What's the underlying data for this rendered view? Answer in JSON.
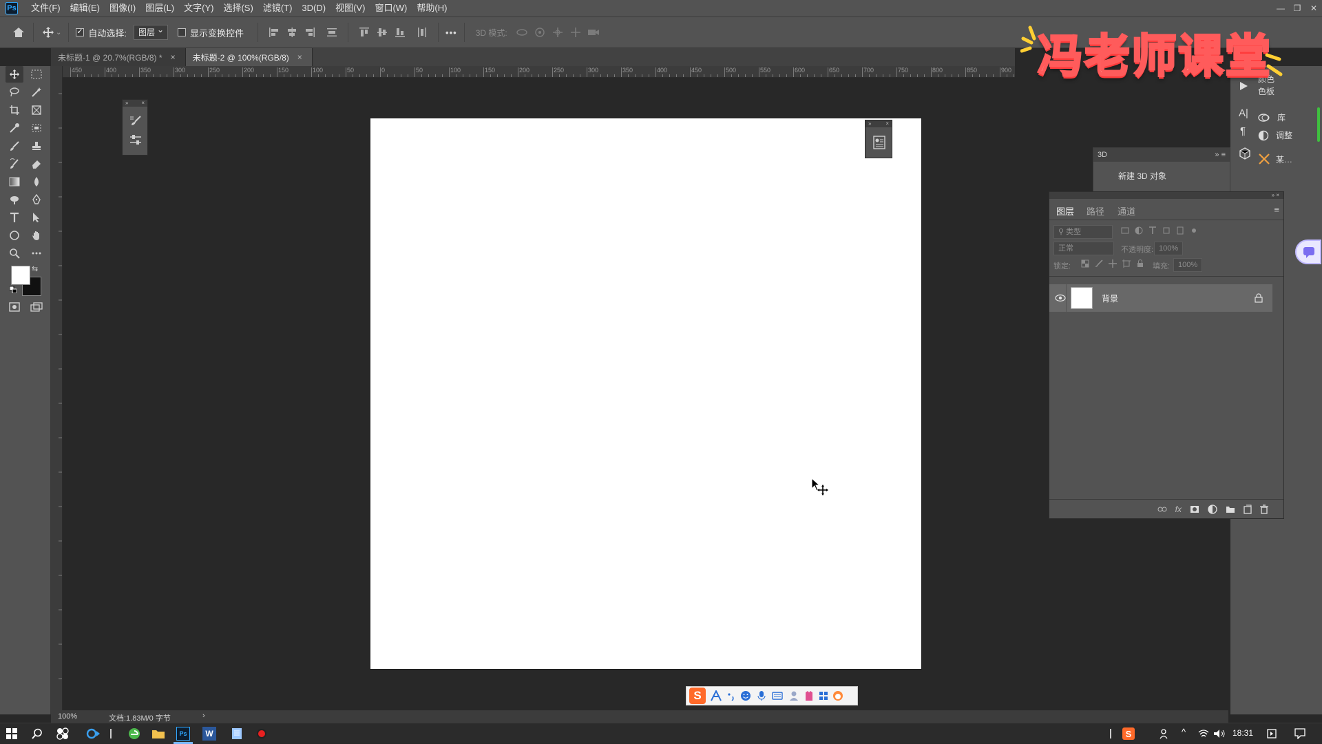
{
  "app": {
    "logo": "Ps",
    "menu": [
      "文件(F)",
      "编辑(E)",
      "图像(I)",
      "图层(L)",
      "文字(Y)",
      "选择(S)",
      "滤镜(T)",
      "3D(D)",
      "视图(V)",
      "窗口(W)",
      "帮助(H)"
    ]
  },
  "options_bar": {
    "auto_select_label": "自动选择:",
    "auto_select_checked": true,
    "auto_select_target": "图层",
    "show_transform_label": "显示变换控件",
    "show_transform_checked": false,
    "more": "•••",
    "mode_3d_label": "3D 模式:"
  },
  "tabs": [
    {
      "label": "未标题-1 @ 20.7%(RGB/8) *",
      "close": "×"
    },
    {
      "label": "未标题-2 @ 100%(RGB/8)",
      "close": "×"
    }
  ],
  "ruler": {
    "top_labels": [
      "450",
      "400",
      "350",
      "300",
      "250",
      "200",
      "150",
      "100",
      "50",
      "0",
      "50",
      "100",
      "150",
      "200",
      "250",
      "300",
      "350",
      "400",
      "450",
      "500",
      "550",
      "600",
      "650",
      "700",
      "750",
      "800",
      "850",
      "900"
    ]
  },
  "right_column": {
    "color_label": "颜色",
    "swatches_label": "色板",
    "library_label": "库",
    "adjust_label": "调整",
    "more_label": "某…"
  },
  "panel_3d": {
    "title": "3D",
    "new_object": "新建 3D 对象"
  },
  "layers_panel": {
    "tabs": [
      "图层",
      "路径",
      "通道"
    ],
    "filter_placeholder": "类型",
    "blend_mode": "正常",
    "opacity_label": "不透明度:",
    "opacity_value": "100%",
    "lock_label": "锁定:",
    "fill_label": "填充:",
    "fill_value": "100%",
    "layers": [
      {
        "name": "背景",
        "visible": true,
        "locked": true
      }
    ],
    "footer_fx": "fx"
  },
  "status": {
    "zoom": "100%",
    "doc": "文档:1.83M/0 字节",
    "arrow": "›"
  },
  "taskbar": {
    "time": "18:31"
  },
  "watermark": {
    "text": "冯老师课堂"
  },
  "colors": {
    "panel_bg": "#535353",
    "workspace_bg": "#282828",
    "accent": "#31a8ff",
    "watermark_stroke": "#ff5b5b"
  }
}
